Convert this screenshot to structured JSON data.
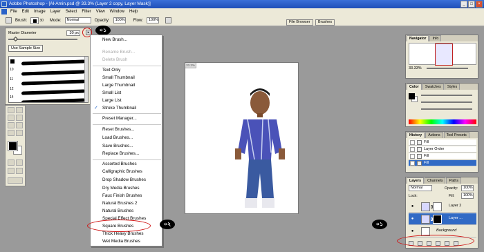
{
  "window": {
    "title": "Adobe Photoshop - [Al-Amin.psd @ 33.3% (Layer 2 copy, Layer Mask)]",
    "minimize": "_",
    "maximize": "□",
    "close": "×"
  },
  "menubar": [
    "File",
    "Edit",
    "Image",
    "Layer",
    "Select",
    "Filter",
    "View",
    "Window",
    "Help"
  ],
  "options_bar": {
    "brush_label": "Brush:",
    "brush_size": "30",
    "mode_label": "Mode:",
    "mode_value": "Normal",
    "opacity_label": "Opacity:",
    "opacity_value": "100%",
    "flow_label": "Flow:",
    "flow_value": "100%"
  },
  "palette_well": {
    "file_browser": "File Browser",
    "brushes": "Brushes"
  },
  "brush_picker": {
    "master_diameter_label": "Master Diameter",
    "master_diameter_value": "30 px",
    "use_sample_size": "Use Sample Size",
    "arrow": "▸",
    "brush_sizes": [
      "10",
      "11",
      "12",
      "14"
    ]
  },
  "brush_menu": {
    "items": [
      {
        "label": "New Brush...",
        "disabled": false,
        "checked": false
      },
      {
        "label": "Rename Brush...",
        "disabled": true,
        "checked": false
      },
      {
        "label": "Delete Brush",
        "disabled": true,
        "checked": false
      },
      {
        "label": "Text Only",
        "disabled": false,
        "checked": false
      },
      {
        "label": "Small Thumbnail",
        "disabled": false,
        "checked": false
      },
      {
        "label": "Large Thumbnail",
        "disabled": false,
        "checked": false
      },
      {
        "label": "Small List",
        "disabled": false,
        "checked": false
      },
      {
        "label": "Large List",
        "disabled": false,
        "checked": false
      },
      {
        "label": "Stroke Thumbnail",
        "disabled": false,
        "checked": true
      },
      {
        "label": "Preset Manager...",
        "disabled": false,
        "checked": false
      },
      {
        "label": "Reset Brushes...",
        "disabled": false,
        "checked": false
      },
      {
        "label": "Load Brushes...",
        "disabled": false,
        "checked": false
      },
      {
        "label": "Save Brushes...",
        "disabled": false,
        "checked": false
      },
      {
        "label": "Replace Brushes...",
        "disabled": false,
        "checked": false
      },
      {
        "label": "Assorted Brushes",
        "disabled": false,
        "checked": false
      },
      {
        "label": "Calligraphic Brushes",
        "disabled": false,
        "checked": false
      },
      {
        "label": "Drop Shadow Brushes",
        "disabled": false,
        "checked": false
      },
      {
        "label": "Dry Media Brushes",
        "disabled": false,
        "checked": false
      },
      {
        "label": "Faux Finish Brushes",
        "disabled": false,
        "checked": false
      },
      {
        "label": "Natural Brushes 2",
        "disabled": false,
        "checked": false
      },
      {
        "label": "Natural Brushes",
        "disabled": false,
        "checked": false
      },
      {
        "label": "Special Effect Brushes",
        "disabled": false,
        "checked": false
      },
      {
        "label": "Square Brushes",
        "disabled": false,
        "checked": false
      },
      {
        "label": "Thick Heavy Brushes",
        "disabled": false,
        "checked": false
      },
      {
        "label": "Wet Media Brushes",
        "disabled": false,
        "checked": false
      }
    ]
  },
  "annotations": {
    "bubble_brushes": "০১",
    "bubble_square": "০২",
    "bubble_layer": "০১"
  },
  "navigator": {
    "tabs": [
      "Navigator",
      "Info"
    ],
    "zoom": "33.33%"
  },
  "color": {
    "tabs": [
      "Color",
      "Swatches",
      "Styles"
    ]
  },
  "history": {
    "tabs": [
      "History",
      "Actions",
      "Tool Presets"
    ],
    "rows": [
      {
        "label": "Fill",
        "selected": false
      },
      {
        "label": "Layer Order",
        "selected": false
      },
      {
        "label": "Fill",
        "selected": false
      },
      {
        "label": "Fill",
        "selected": true
      }
    ]
  },
  "layers": {
    "tabs": [
      "Layers",
      "Channels",
      "Paths"
    ],
    "blend_mode": "Normal",
    "opacity_label": "Opacity:",
    "opacity_value": "100%",
    "lock_label": "Lock:",
    "fill_label": "Fill:",
    "fill_value": "100%",
    "rows": [
      {
        "name": "Layer 2",
        "selected": false
      },
      {
        "name": "Layer ...",
        "selected": true
      },
      {
        "name": "Background",
        "selected": false
      }
    ]
  },
  "doc": {
    "corner_label": "33.3%"
  }
}
